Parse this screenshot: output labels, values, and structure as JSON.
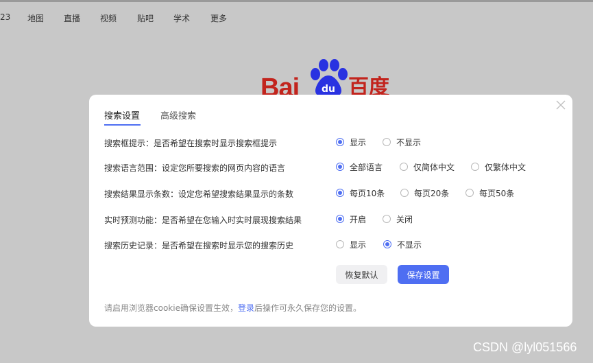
{
  "topnav": [
    "23",
    "地图",
    "直播",
    "视频",
    "贴吧",
    "学术",
    "更多"
  ],
  "logo": {
    "text_latin": "Bai",
    "text_du": "du",
    "text_cn": "百度"
  },
  "dialog": {
    "tabs": [
      "搜索设置",
      "高级搜索"
    ],
    "active_tab": 0,
    "rows": [
      {
        "label": "搜索框提示：是否希望在搜索时显示搜索框提示",
        "options": [
          "显示",
          "不显示"
        ],
        "selected": 0
      },
      {
        "label": "搜索语言范围：设定您所要搜索的网页内容的语言",
        "options": [
          "全部语言",
          "仅简体中文",
          "仅繁体中文"
        ],
        "selected": 0
      },
      {
        "label": "搜索结果显示条数：设定您希望搜索结果显示的条数",
        "options": [
          "每页10条",
          "每页20条",
          "每页50条"
        ],
        "selected": 0
      },
      {
        "label": "实时预测功能：是否希望在您输入时实时展现搜索结果",
        "options": [
          "开启",
          "关闭"
        ],
        "selected": 0
      },
      {
        "label": "搜索历史记录：是否希望在搜索时显示您的搜索历史",
        "options": [
          "显示",
          "不显示"
        ],
        "selected": 1
      }
    ],
    "buttons": {
      "reset": "恢复默认",
      "save": "保存设置"
    },
    "footnote": {
      "before": "请启用浏览器cookie确保设置生效，",
      "link": "登录",
      "after": "后操作可永久保存您的设置。"
    }
  },
  "watermark": "CSDN @lyl051566",
  "colors": {
    "accent": "#4e6ef2",
    "overlay": "#c8c8c8",
    "logo_red": "#c2241d",
    "logo_blue": "#2932e1"
  },
  "icons": {
    "close": "close-icon",
    "paw": "baidu-paw-icon"
  }
}
